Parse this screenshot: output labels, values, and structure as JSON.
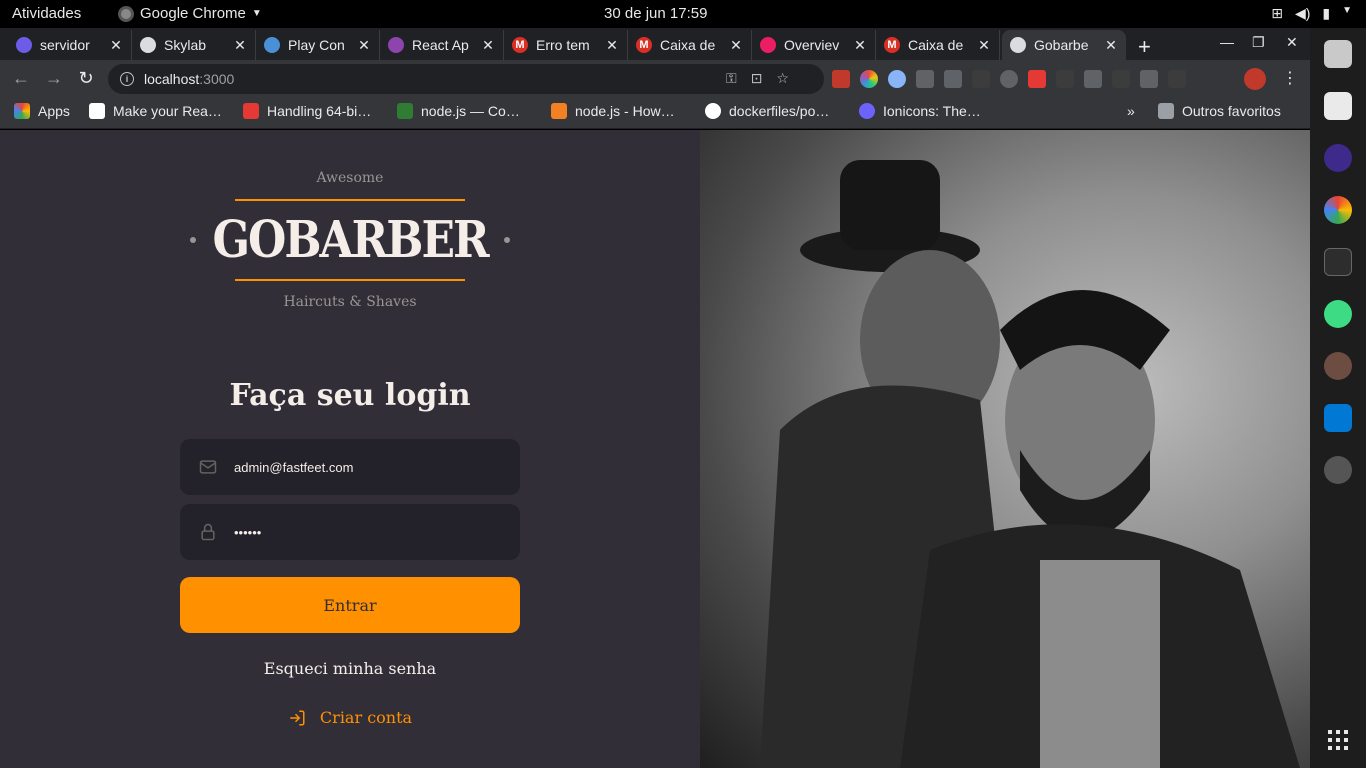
{
  "system_bar": {
    "activities": "Atividades",
    "app_name": "Google Chrome",
    "clock": "30 de jun  17:59"
  },
  "tabs": [
    {
      "title": "servidor",
      "favicon_color": "#6c5ce7"
    },
    {
      "title": "Skylab",
      "favicon_color": "#5f6368"
    },
    {
      "title": "Play Con",
      "favicon_color": "#4a90d9"
    },
    {
      "title": "React Ap",
      "favicon_color": "#8e44ad"
    },
    {
      "title": "Erro tem",
      "favicon_color": "#d93025"
    },
    {
      "title": "Caixa de",
      "favicon_color": "#d93025"
    },
    {
      "title": "Overviev",
      "favicon_color": "#e91e63"
    },
    {
      "title": "Caixa de",
      "favicon_color": "#d93025"
    },
    {
      "title": "Gobarbe",
      "favicon_color": "#5f6368"
    }
  ],
  "address_bar": {
    "host": "localhost",
    "port": ":3000"
  },
  "bookmarks": [
    {
      "label": "Apps",
      "icon_color": "#ea4335"
    },
    {
      "label": "Make your Rea…",
      "icon_color": "#ffffff"
    },
    {
      "label": "Handling 64-bi…",
      "icon_color": "#e53935"
    },
    {
      "label": "node.js — Co…",
      "icon_color": "#2e7d32"
    },
    {
      "label": "node.js - How…",
      "icon_color": "#f48024"
    },
    {
      "label": "dockerfiles/po…",
      "icon_color": "#ffffff"
    },
    {
      "label": "Ionicons: The…",
      "icon_color": "#6c63ff"
    },
    {
      "label": "Outros favoritos",
      "icon_color": "#9aa0a6"
    }
  ],
  "logo": {
    "top_text": "Awesome",
    "brand": "GOBARBER",
    "bottom_text": "Haircuts & Shaves"
  },
  "login": {
    "title": "Faça seu login",
    "email_value": "admin@fastfeet.com",
    "password_value": "••••••",
    "submit_label": "Entrar",
    "forgot_label": "Esqueci minha senha",
    "create_label": "Criar conta"
  },
  "colors": {
    "accent": "#ff9000",
    "background": "#312e38",
    "input_background": "#232129",
    "text": "#f4ede8",
    "muted": "#999591"
  }
}
